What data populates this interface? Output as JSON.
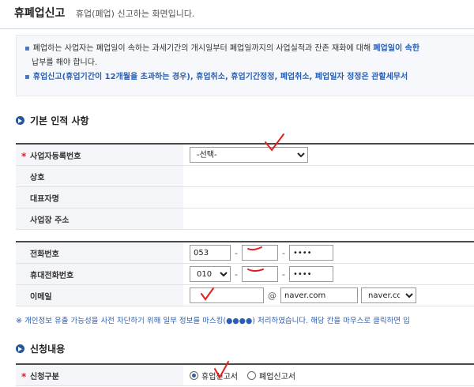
{
  "header": {
    "title": "휴폐업신고",
    "subtitle": "휴업(폐업) 신고하는 화면입니다."
  },
  "notice": {
    "line1_a": "폐업하는 사업자는 폐업일이 속하는 과세기간의 개시일부터 폐업일까지의 사업실적과 잔존 재화에 대해",
    "line1_b": "폐업일이 속한",
    "line1_c": "납부를 해야 합니다.",
    "line2": "휴업신고(휴업기간이 12개월을 초과하는 경우), 휴업취소, 휴업기간정정, 폐업취소, 폐업일자 정정은 관할세무서"
  },
  "section1": {
    "title": "기본 인적 사항"
  },
  "basic_info": {
    "biz_reg_label": "사업자등록번호",
    "biz_reg_select": "-선택-",
    "company_label": "상호",
    "rep_label": "대표자명",
    "address_label": "사업장 주소"
  },
  "contact": {
    "phone_label": "전화번호",
    "phone_part1": "053",
    "phone_part2": "",
    "phone_part3": "••••",
    "mobile_label": "휴대전화번호",
    "mobile_part1": "010",
    "mobile_part2": "",
    "mobile_part3": "••••",
    "email_label": "이메일",
    "email_id": "",
    "email_at": "@",
    "email_domain": "naver.com",
    "email_domain_select": "naver.com"
  },
  "privacy_note": "※ 개인정보 유출 가능성을 사전 차단하기 위해 일부 정보를 마스킹(●●●●) 처리하였습니다. 해당 칸을 마우스로 클릭하면 입",
  "section2": {
    "title": "신청내용"
  },
  "application": {
    "type_label": "신청구분",
    "option1": "휴업신고서",
    "option2": "폐업신고서",
    "selected": "휴업신고서"
  },
  "colors": {
    "accent": "#25569c",
    "annotation": "#e21f1f"
  }
}
